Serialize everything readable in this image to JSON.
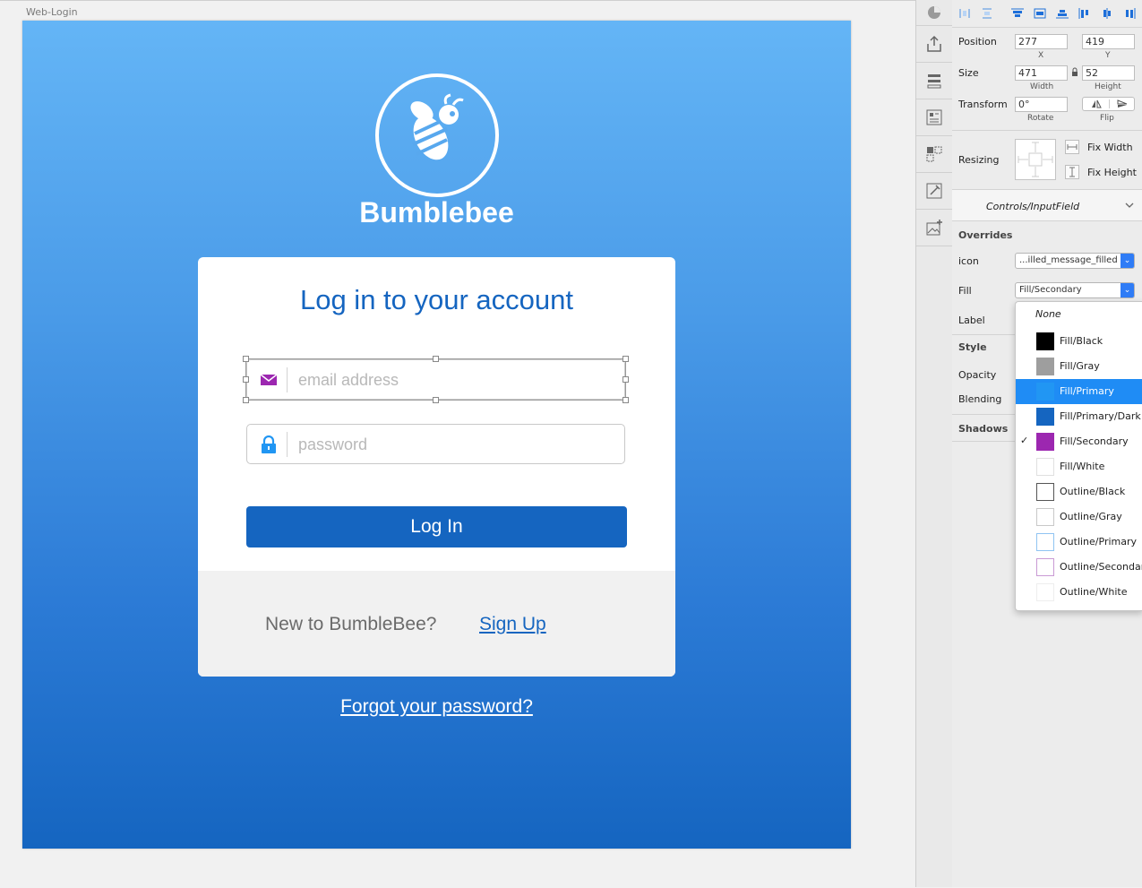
{
  "canvas": {
    "artboard_label": "Web-Login",
    "brand_name": "Bumblebee",
    "card_title": "Log in to your account",
    "email_placeholder": "email address",
    "password_placeholder": "password",
    "login_label": "Log In",
    "new_user_text": "New to BumbleBee?",
    "signup_link": "Sign Up",
    "forgot_link": "Forgot your password?"
  },
  "colors": {
    "primary": "#1565c0",
    "secondary": "#9c27b0",
    "light_primary": "#64b5f6",
    "highlight": "#1f8cf5"
  },
  "inspector": {
    "position_label": "Position",
    "position_x": "277",
    "position_y": "419",
    "x_label": "X",
    "y_label": "Y",
    "size_label": "Size",
    "width": "471",
    "height": "52",
    "width_label": "Width",
    "height_label": "Height",
    "transform_label": "Transform",
    "rotate": "0°",
    "rotate_label": "Rotate",
    "flip_label": "Flip",
    "resizing_label": "Resizing",
    "fix_width": "Fix Width",
    "fix_height": "Fix Height",
    "symbol_name": "Controls/InputField",
    "overrides_label": "Overrides",
    "icon_label": "icon",
    "icon_value": "...illed_message_filled",
    "fill_label": "Fill",
    "fill_value": "Fill/Secondary",
    "label_label": "Label",
    "style_label": "Style",
    "opacity_label": "Opacity",
    "blending_label": "Blending",
    "shadows_label": "Shadows"
  },
  "fill_menu": {
    "none_label": "None",
    "items": [
      {
        "label": "Fill/Black",
        "color": "#000000",
        "outline": false
      },
      {
        "label": "Fill/Gray",
        "color": "#9e9e9e",
        "outline": false
      },
      {
        "label": "Fill/Primary",
        "color": "#2196f3",
        "outline": false,
        "highlighted": true
      },
      {
        "label": "Fill/Primary/Dark",
        "color": "#1565c0",
        "outline": false
      },
      {
        "label": "Fill/Secondary",
        "color": "#9c27b0",
        "outline": false,
        "checked": true
      },
      {
        "label": "Fill/White",
        "color": "#ffffff",
        "outline": false
      },
      {
        "label": "Outline/Black",
        "color": "#555555",
        "outline": true
      },
      {
        "label": "Outline/Gray",
        "color": "#c8c8c8",
        "outline": true
      },
      {
        "label": "Outline/Primary",
        "color": "#90c4f2",
        "outline": true
      },
      {
        "label": "Outline/Secondary",
        "color": "#c99ad4",
        "outline": true
      },
      {
        "label": "Outline/White",
        "color": "#eeeeee",
        "outline": true
      }
    ]
  }
}
